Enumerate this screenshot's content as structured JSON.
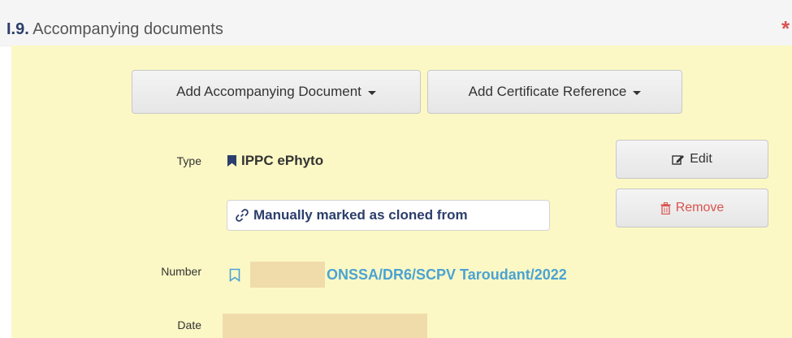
{
  "section": {
    "number": "I.9.",
    "title": "Accompanying documents",
    "required_marker": "*"
  },
  "toolbar": {
    "add_document_label": "Add Accompanying Document",
    "add_certificate_label": "Add Certificate Reference"
  },
  "document": {
    "type_label": "Type",
    "type_value": "IPPC ePhyto",
    "cloned_badge": "Manually marked as cloned from",
    "number_label": "Number",
    "number_value": "ONSSA/DR6/SCPV Taroudant/2022",
    "date_label": "Date",
    "edit_label": "Edit",
    "remove_label": "Remove"
  },
  "colors": {
    "panel_background": "#fcf8c5",
    "link_blue": "#4aa3d3",
    "title_navy": "#2c3e6b",
    "danger_red": "#d9534f"
  }
}
